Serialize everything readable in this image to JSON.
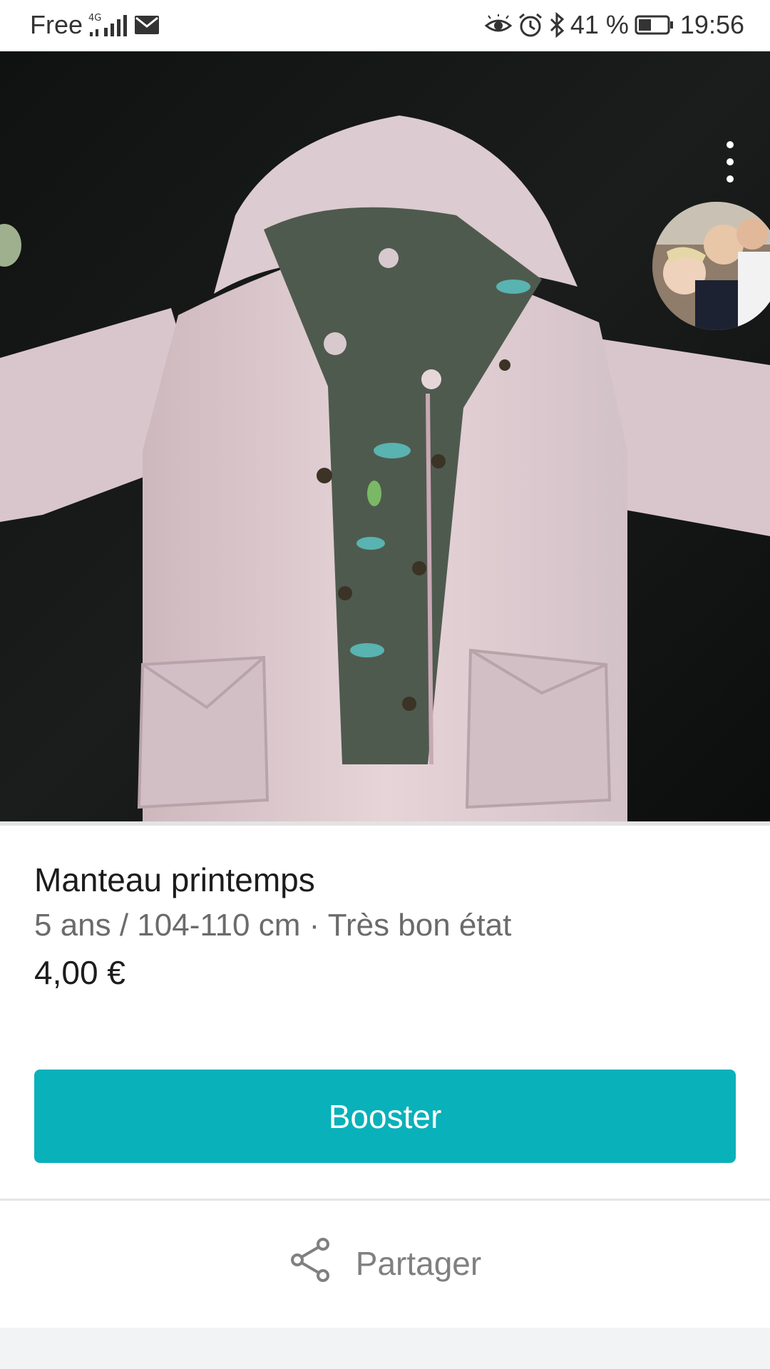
{
  "status_bar": {
    "carrier": "Free",
    "network": "4G",
    "battery": "41 %",
    "battery_level": 0.41,
    "time": "19:56",
    "icons": [
      "signal-icon",
      "mail-icon",
      "eye-icon",
      "alarm-icon",
      "bluetooth-icon",
      "battery-icon"
    ]
  },
  "listing": {
    "title": "Manteau printemps",
    "details": "5 ans / 104-110 cm · Très bon état",
    "price": "4,00 €"
  },
  "actions": {
    "booster_label": "Booster",
    "share_label": "Partager"
  },
  "colors": {
    "accent": "#09b1ba",
    "photo_background": "#121413",
    "jacket": "#e2cfd3",
    "lining": "#4f5a4e"
  }
}
